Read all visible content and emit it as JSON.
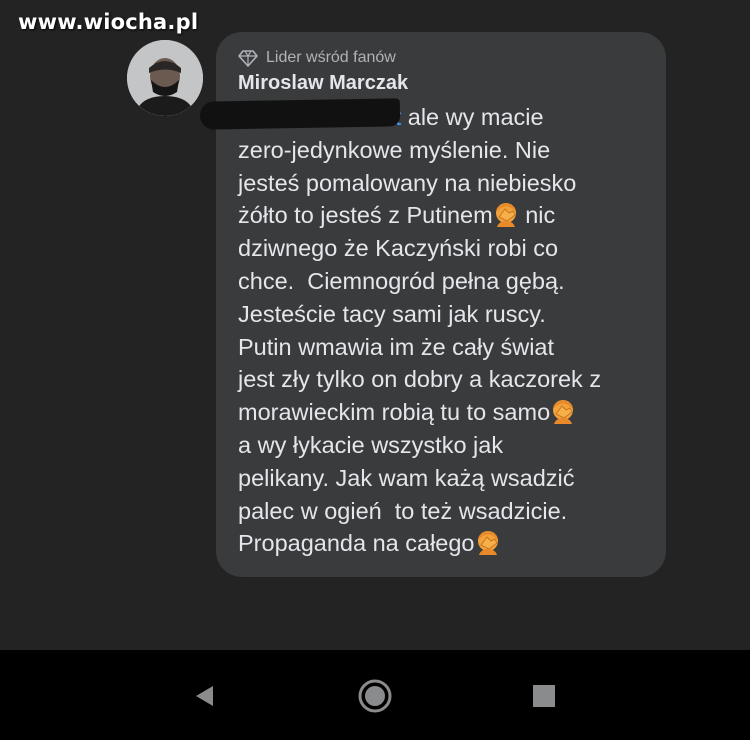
{
  "watermark": "www.wiocha.pl",
  "comment": {
    "badge_label": "Lider wśród fanów",
    "author": "Miroslaw Marczak",
    "mention_fragment": "tt",
    "lines": [
      "ale wy macie",
      "zero-jedynkowe myślenie. Nie",
      "jesteś pomalowany na niebiesko",
      "żółto to jesteś z Putinem",
      " nic",
      "dziwnego że Kaczyński robi co",
      "chce.  Ciemnogród pełna gębą.",
      "Jesteście tacy sami jak ruscy.",
      "Putin wmawia im że cały świat",
      "jest zły tylko on dobry a kaczorek z",
      "morawieckim robią tu to samo",
      "a wy łykacie wszystko jak",
      "pelikany. Jak wam każą wsadzić",
      "palec w ogień  to też wsadzicie.",
      "Propaganda na całego"
    ],
    "emoji_name": "facepalm-emoji"
  },
  "colors": {
    "background": "#232324",
    "bubble": "#3a3b3c",
    "text": "#e4e6eb",
    "secondary_text": "#b0b3b8",
    "mention": "#4599ff",
    "navbar": "#000000"
  },
  "navbar": {
    "icons": [
      "back-triangle-icon",
      "home-circle-icon",
      "recents-square-icon"
    ]
  }
}
